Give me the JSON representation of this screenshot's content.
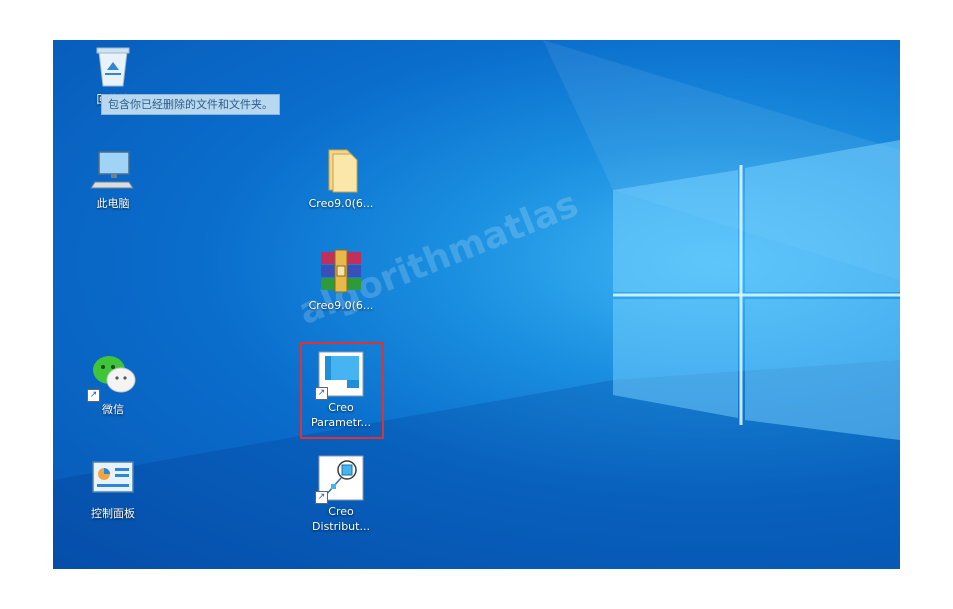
{
  "desktop": {
    "icons": [
      {
        "label": "回收站",
        "icon": "recycle-bin-icon"
      },
      {
        "label": "此电脑",
        "icon": "computer-icon"
      },
      {
        "label": "微信",
        "icon": "wechat-icon"
      },
      {
        "label": "控制面板",
        "icon": "control-panel-icon"
      },
      {
        "label": "Creo9.0(6...",
        "icon": "folder-icon"
      },
      {
        "label": "Creo9.0(6...",
        "icon": "winrar-archive-icon"
      },
      {
        "label": "Creo Parametr...",
        "icon": "creo-parametric-icon"
      },
      {
        "label": "Creo Distribut...",
        "icon": "creo-distributed-icon"
      }
    ],
    "tooltip": "包含你已经删除的文件和文件夹。",
    "watermark": "algorithmatlas",
    "selected_icon": "Creo Parametr..."
  },
  "colors": {
    "desktop_blue": "#0a6dcc",
    "highlight_red": "#e03232"
  }
}
